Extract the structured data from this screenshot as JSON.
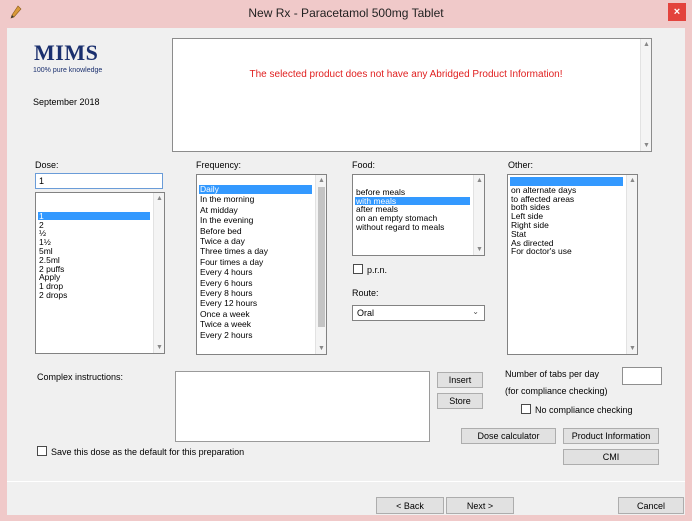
{
  "window": {
    "title": "New Rx - Paracetamol  500mg Tablet",
    "close_glyph": "×",
    "app_icon": "pen-icon"
  },
  "brand": {
    "logo": "MIMS",
    "tagline": "100% pure knowledge",
    "date": "September 2018"
  },
  "info": {
    "message": "The selected product does not have any Abridged Product Information!"
  },
  "dose": {
    "label": "Dose:",
    "value": "1",
    "options": [
      "",
      "1",
      "2",
      "½",
      "1½",
      "5ml",
      "2.5ml",
      "2 puffs",
      "Apply",
      "1 drop",
      "2 drops"
    ],
    "selected_index": 1
  },
  "frequency": {
    "label": "Frequency:",
    "options": [
      "Daily",
      "In the morning",
      "At midday",
      "In the evening",
      "Before bed",
      "Twice a day",
      "Three times a day",
      "Four times a day",
      "Every 4 hours",
      "Every 6 hours",
      "Every 8 hours",
      "Every 12 hours",
      "Once a week",
      "Twice a week",
      "Every 2 hours"
    ],
    "selected_index": 0
  },
  "food": {
    "label": "Food:",
    "options": [
      "",
      "before meals",
      "with meals",
      "after meals",
      "on an empty stomach",
      "without regard to meals"
    ],
    "selected_index": 2
  },
  "other": {
    "label": "Other:",
    "options": [
      "",
      "on alternate days",
      "to affected areas",
      "both sides",
      "Left side",
      "Right side",
      "Stat",
      "As directed",
      "For doctor's use"
    ],
    "selected_index": 0
  },
  "prn": {
    "label": "p.r.n.",
    "checked": false
  },
  "route": {
    "label": "Route:",
    "value": "Oral"
  },
  "complex": {
    "label": "Complex instructions:",
    "value": ""
  },
  "buttons": {
    "insert": "Insert",
    "store": "Store",
    "dose_calculator": "Dose calculator",
    "product_information": "Product Information",
    "cmi": "CMI",
    "back": "< Back",
    "next": "Next >",
    "cancel": "Cancel"
  },
  "tabs_per_day": {
    "label_line1": "Number of tabs per day",
    "label_line2": "(for compliance checking)",
    "value": ""
  },
  "no_compliance": {
    "label": "No compliance checking",
    "checked": false
  },
  "save_default": {
    "label": "Save this dose as the default for this preparation",
    "checked": false
  },
  "colors": {
    "title_bar": "#f0c9c9",
    "close_button": "#e3433d",
    "selection": "#3399ff",
    "logo": "#1a2f6e",
    "message": "#e02020"
  }
}
